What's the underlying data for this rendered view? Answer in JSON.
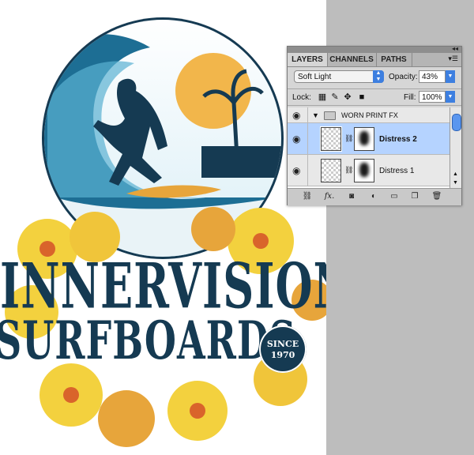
{
  "artwork": {
    "line1": "INNERVISIONS",
    "line2": "SURFBOARDS",
    "badge_top": "SINCE",
    "badge_year": "1970",
    "colors": {
      "navy": "#153a52",
      "yellow": "#f3d13e",
      "orange": "#e7a53b",
      "sky": "#7fc3dd"
    }
  },
  "panel": {
    "tabs": [
      {
        "label": "LAYERS",
        "active": true
      },
      {
        "label": "CHANNELS",
        "active": false
      },
      {
        "label": "PATHS",
        "active": false
      }
    ],
    "blend_mode": "Soft Light",
    "opacity_label": "Opacity:",
    "opacity_value": "43%",
    "lock_label": "Lock:",
    "fill_label": "Fill:",
    "fill_value": "100%",
    "group_name": "WORN PRINT FX",
    "layers": [
      {
        "name": "Distress 2",
        "selected": true
      },
      {
        "name": "Distress 1",
        "selected": false
      }
    ],
    "bottom_icons": [
      "link-layers-icon",
      "fx-icon",
      "add-mask-icon",
      "adjustment-layer-icon",
      "new-group-icon",
      "new-layer-icon",
      "trash-icon"
    ]
  }
}
